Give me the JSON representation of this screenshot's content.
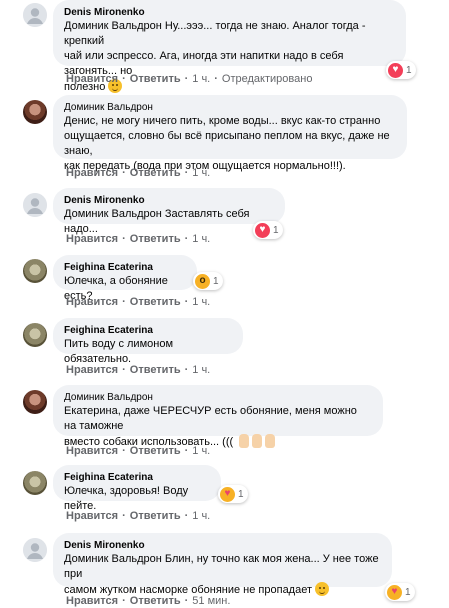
{
  "comments": [
    {
      "author": "Denis Mironenko",
      "mention": "Доминик Вальдрон",
      "text_lines": [
        "Ну...эээ... тогда не знаю. Аналог тогда - крепкий",
        "чай или эспрессо. Ага, иногда эти напитки надо в себя загонять... но",
        "полезно"
      ],
      "reaction_count": "1",
      "actions": {
        "like": "Нравится",
        "reply": "Ответить",
        "time": "1 ч.",
        "extra": "Отредактировано"
      }
    },
    {
      "author": "Доминик Вальдрон",
      "text_lines": [
        "Денис, не могу ничего пить, кроме воды... вкус как-то странно",
        "ощущается, словно бы всё присыпано пеплом на вкус, даже не знаю,",
        "как передать (вода при этом ощущается нормально!!!)."
      ],
      "actions": {
        "like": "Нравится",
        "reply": "Ответить",
        "time": "1 ч."
      }
    },
    {
      "author": "Denis Mironenko",
      "mention": "Доминик Вальдрон",
      "text_lines": [
        "Заставлять себя надо..."
      ],
      "reaction_count": "1",
      "actions": {
        "like": "Нравится",
        "reply": "Ответить",
        "time": "1 ч."
      }
    },
    {
      "author": "Feighina Ecaterina",
      "text_lines": [
        "Юлечка, а обоняние есть?"
      ],
      "reaction_count": "1",
      "actions": {
        "like": "Нравится",
        "reply": "Ответить",
        "time": "1 ч."
      }
    },
    {
      "author": "Feighina Ecaterina",
      "text_lines": [
        "Пить воду с лимоном обязательно."
      ],
      "actions": {
        "like": "Нравится",
        "reply": "Ответить",
        "time": "1 ч."
      }
    },
    {
      "author": "Доминик Вальдрон",
      "text_lines": [
        "Екатерина, даже ЧЕРЕСЧУР есть обоняние, меня можно на таможне",
        "вместо собаки использовать... ((("
      ],
      "actions": {
        "like": "Нравится",
        "reply": "Ответить",
        "time": "1 ч."
      }
    },
    {
      "author": "Feighina Ecaterina",
      "text_lines": [
        "Юлечка, здоровья! Воду пейте."
      ],
      "reaction_count": "1",
      "actions": {
        "like": "Нравится",
        "reply": "Ответить",
        "time": "1 ч."
      }
    },
    {
      "author": "Denis Mironenko",
      "mention": "Доминик Вальдрон",
      "text_lines": [
        "Блин, ну точно как моя жена... У нее тоже при",
        "самом жутком насморке обоняние не пропадает"
      ],
      "reaction_count": "1",
      "actions": {
        "like": "Нравится",
        "reply": "Ответить",
        "time": "51 мин."
      }
    }
  ],
  "colors": {
    "bubble": "#f0f2f5",
    "muted": "#65676b",
    "love": "#f33e58",
    "emoji": "#f7b125"
  }
}
